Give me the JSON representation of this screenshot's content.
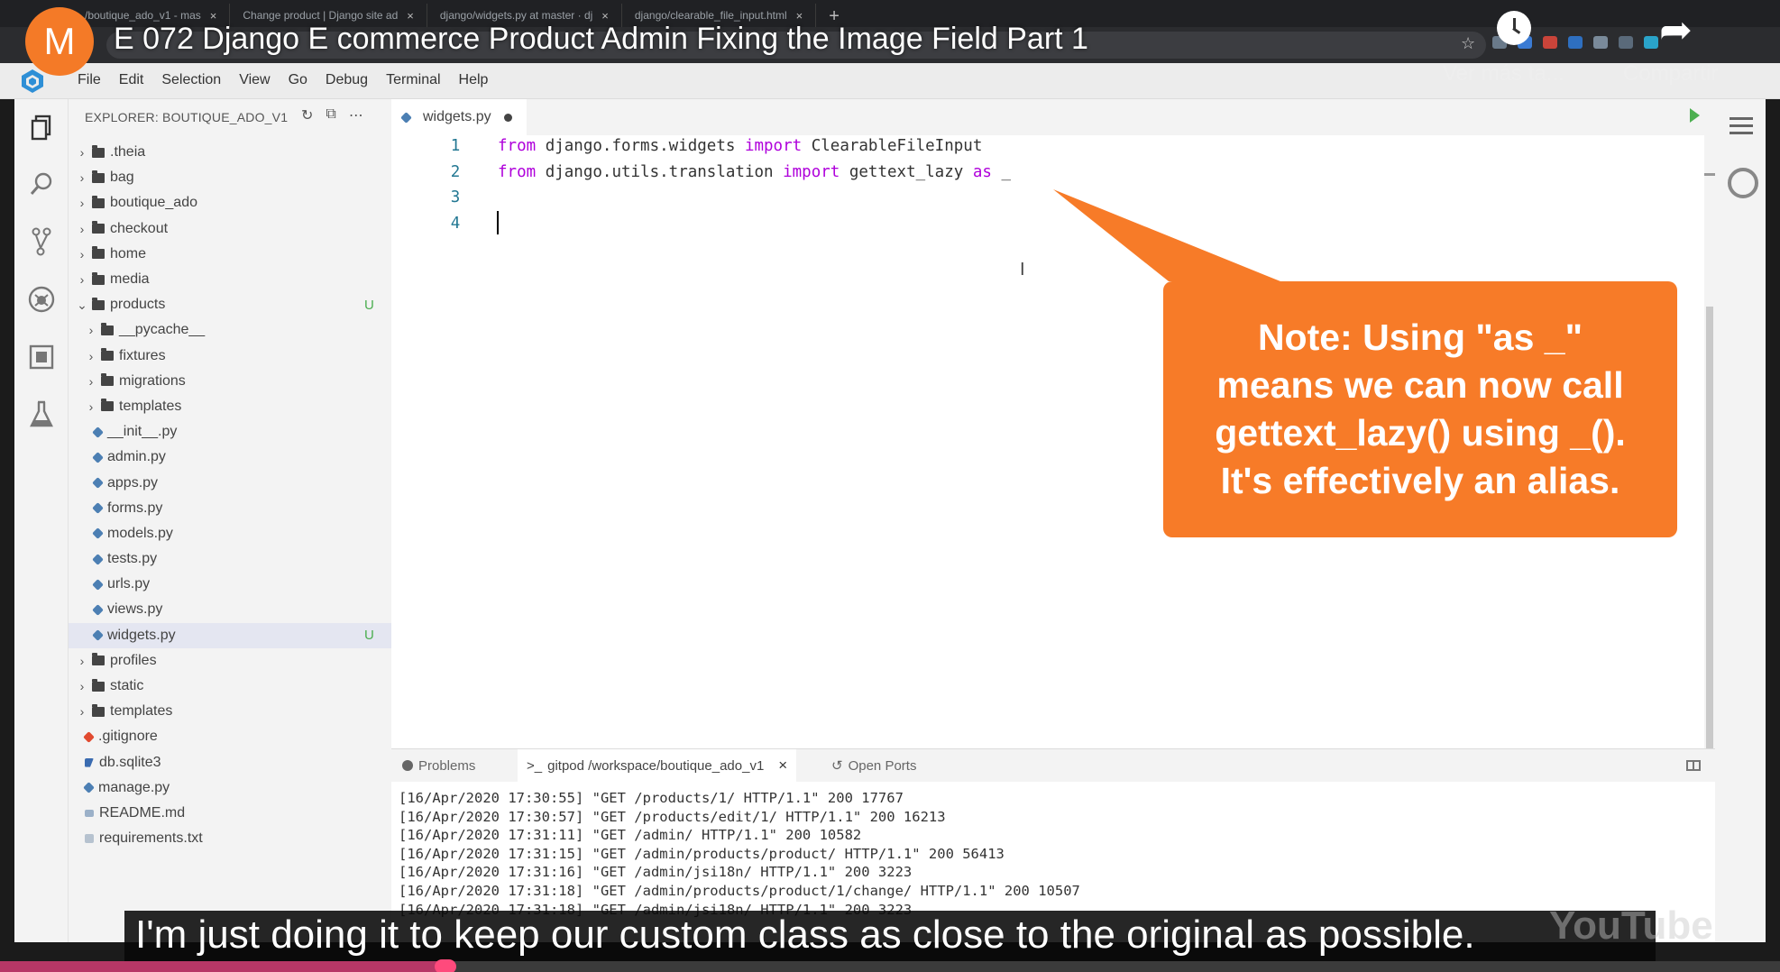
{
  "browser": {
    "tabs": [
      {
        "label": "/boutique_ado_v1 - mas"
      },
      {
        "label": "Change product | Django site ad"
      },
      {
        "label": "django/widgets.py at master · dj"
      },
      {
        "label": "django/clearable_file_input.html"
      }
    ],
    "close_glyph": "×",
    "new_tab_glyph": "+"
  },
  "youtube": {
    "avatar_letter": "M",
    "title": "E 072 Django E commerce Product Admin Fixing the Image Field Part 1",
    "watch_later": "Ver más ta...",
    "share": "Compartir",
    "subtitle": "I'm just doing it to keep our custom class as close to the original as possible.",
    "logo_text": "YouTube",
    "progress": 0.25
  },
  "ide": {
    "menu": [
      "File",
      "Edit",
      "Selection",
      "View",
      "Go",
      "Debug",
      "Terminal",
      "Help"
    ],
    "explorer_title": "EXPLORER: BOUTIQUE_ADO_V1",
    "tree": [
      {
        "label": ".theia",
        "kind": "folder",
        "depth": 0,
        "open": false
      },
      {
        "label": "bag",
        "kind": "folder",
        "depth": 0,
        "open": false
      },
      {
        "label": "boutique_ado",
        "kind": "folder",
        "depth": 0,
        "open": false
      },
      {
        "label": "checkout",
        "kind": "folder",
        "depth": 0,
        "open": false
      },
      {
        "label": "home",
        "kind": "folder",
        "depth": 0,
        "open": false
      },
      {
        "label": "media",
        "kind": "folder",
        "depth": 0,
        "open": false
      },
      {
        "label": "products",
        "kind": "folder",
        "depth": 0,
        "open": true,
        "badge": "U"
      },
      {
        "label": "__pycache__",
        "kind": "folder",
        "depth": 1,
        "open": false
      },
      {
        "label": "fixtures",
        "kind": "folder",
        "depth": 1,
        "open": false
      },
      {
        "label": "migrations",
        "kind": "folder",
        "depth": 1,
        "open": false
      },
      {
        "label": "templates",
        "kind": "folder",
        "depth": 1,
        "open": false
      },
      {
        "label": "__init__.py",
        "kind": "py",
        "depth": 1
      },
      {
        "label": "admin.py",
        "kind": "py",
        "depth": 1
      },
      {
        "label": "apps.py",
        "kind": "py",
        "depth": 1
      },
      {
        "label": "forms.py",
        "kind": "py",
        "depth": 1
      },
      {
        "label": "models.py",
        "kind": "py",
        "depth": 1
      },
      {
        "label": "tests.py",
        "kind": "py",
        "depth": 1
      },
      {
        "label": "urls.py",
        "kind": "py",
        "depth": 1
      },
      {
        "label": "views.py",
        "kind": "py",
        "depth": 1
      },
      {
        "label": "widgets.py",
        "kind": "py",
        "depth": 1,
        "selected": true,
        "badge": "U"
      },
      {
        "label": "profiles",
        "kind": "folder",
        "depth": 0,
        "open": false
      },
      {
        "label": "static",
        "kind": "folder",
        "depth": 0,
        "open": false
      },
      {
        "label": "templates",
        "kind": "folder",
        "depth": 0,
        "open": false
      },
      {
        "label": ".gitignore",
        "kind": "git",
        "depth": 0
      },
      {
        "label": "db.sqlite3",
        "kind": "db",
        "depth": 0
      },
      {
        "label": "manage.py",
        "kind": "py",
        "depth": 0
      },
      {
        "label": "README.md",
        "kind": "md",
        "depth": 0
      },
      {
        "label": "requirements.txt",
        "kind": "txt",
        "depth": 0
      }
    ],
    "editor": {
      "tab_label": "widgets.py",
      "lines": [
        {
          "num": "1",
          "parts": [
            {
              "t": "from",
              "kw": true
            },
            {
              "t": " django.forms.widgets "
            },
            {
              "t": "import",
              "kw": true
            },
            {
              "t": " ClearableFileInput"
            }
          ]
        },
        {
          "num": "2",
          "parts": [
            {
              "t": "from",
              "kw": true
            },
            {
              "t": " django.utils.translation "
            },
            {
              "t": "import",
              "kw": true
            },
            {
              "t": " gettext_lazy "
            },
            {
              "t": "as",
              "kw": true
            },
            {
              "t": " _"
            }
          ]
        },
        {
          "num": "3",
          "parts": []
        },
        {
          "num": "4",
          "parts": []
        }
      ]
    },
    "panel": {
      "problems_label": "Problems",
      "terminal_label": "gitpod /workspace/boutique_ado_v1",
      "terminal_prompt_glyph": ">_",
      "ports_label": "Open Ports",
      "terminal_lines": [
        "[16/Apr/2020 17:30:55] \"GET /products/1/ HTTP/1.1\" 200 17767",
        "[16/Apr/2020 17:30:57] \"GET /products/edit/1/ HTTP/1.1\" 200 16213",
        "[16/Apr/2020 17:31:11] \"GET /admin/ HTTP/1.1\" 200 10582",
        "[16/Apr/2020 17:31:15] \"GET /admin/products/product/ HTTP/1.1\" 200 56413",
        "[16/Apr/2020 17:31:16] \"GET /admin/jsi18n/ HTTP/1.1\" 200 3223",
        "[16/Apr/2020 17:31:18] \"GET /admin/products/product/1/change/ HTTP/1.1\" 200 10507",
        "[16/Apr/2020 17:31:18] \"GET /admin/jsi18n/ HTTP/1.1\" 200 3223"
      ]
    }
  },
  "callout": {
    "lines": [
      "Note: Using \"as _\"",
      "means we can now call",
      "gettext_lazy() using _().",
      "It's effectively an alias."
    ]
  },
  "colors": {
    "callout": "#f77b28",
    "avatar": "#f47a27",
    "keyword": "#af00db",
    "line_number": "#237893",
    "badge_untracked": "#4caf50",
    "progress": "#b73766"
  }
}
